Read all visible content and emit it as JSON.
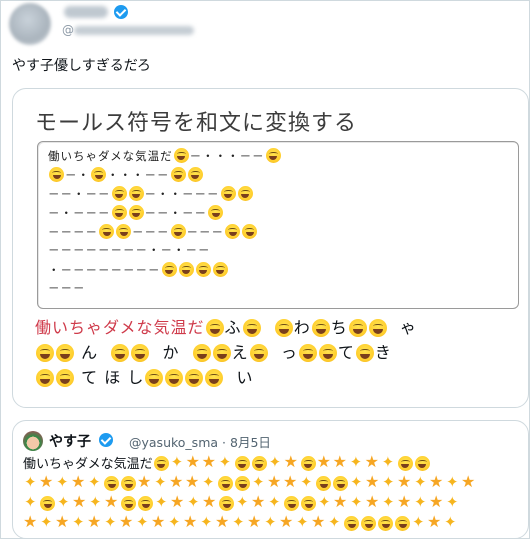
{
  "tweet": {
    "handle_prefix": "@",
    "text": "やす子優しすぎるだろ"
  },
  "card": {
    "title": "モールス符号を和文に変換する",
    "answer_red": "働いちゃダメな気温だ",
    "answer_rows": [
      [
        "ふ",
        "わ",
        "ち",
        "ゃ"
      ],
      [
        "ん",
        "か",
        "え",
        "っ",
        "て",
        "き"
      ],
      [
        "て",
        "ほ",
        "し",
        "い"
      ]
    ]
  },
  "quote": {
    "name": "やす子",
    "handle": "@yasuko_sma",
    "dot": "·",
    "date": "8月5日",
    "text": "働いちゃダメな気温だ"
  },
  "icons": {
    "emoji": "grinning-squinting-face-icon",
    "sparkles": "sparkles-icon",
    "star": "star-icon",
    "verified": "verified-badge-icon"
  },
  "colors": {
    "accent": "#1d9bf0",
    "answer_red": "#cf3a4a"
  }
}
